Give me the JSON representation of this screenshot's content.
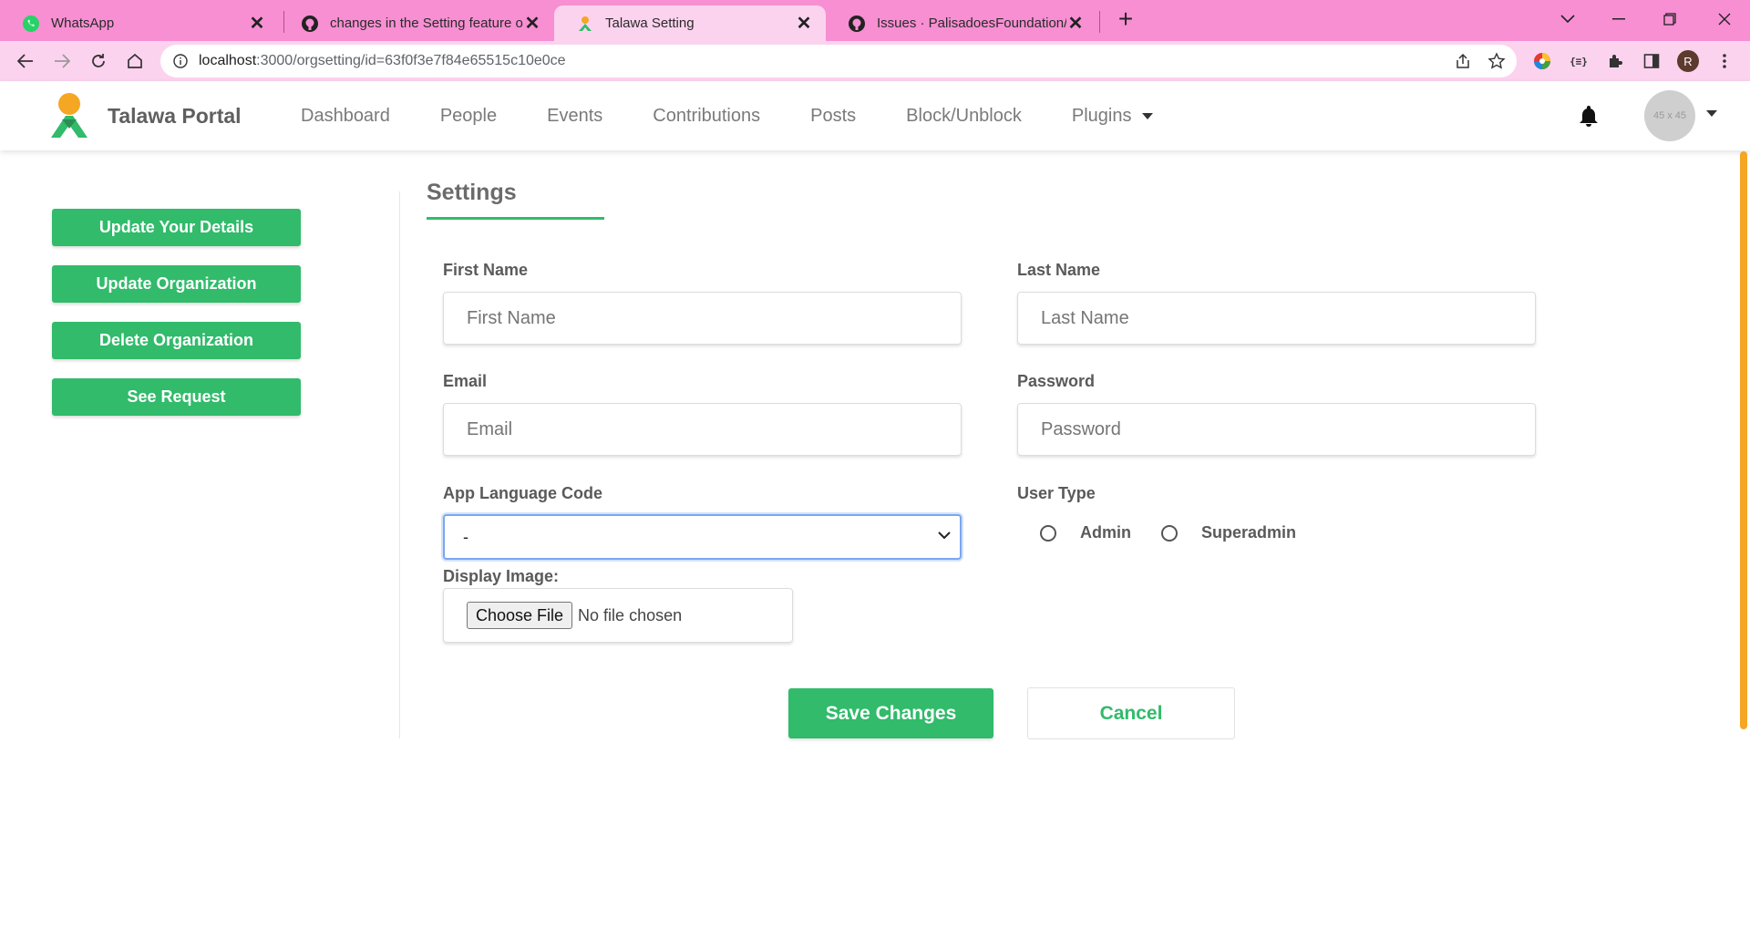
{
  "browser": {
    "tabs": [
      {
        "title": "WhatsApp",
        "icon": "whatsapp-icon"
      },
      {
        "title": "changes in the Setting feature of",
        "icon": "github-icon"
      },
      {
        "title": "Talawa Setting",
        "icon": "talawa-icon",
        "active": true
      },
      {
        "title": "Issues · PalisadoesFoundation/ta",
        "icon": "github-icon"
      }
    ],
    "url_host": "localhost",
    "url_path": ":3000/orgsetting/id=63f0f3e7f84e65515c10e0ce",
    "profile_initial": "R"
  },
  "header": {
    "brand": "Talawa Portal",
    "nav": [
      "Dashboard",
      "People",
      "Events",
      "Contributions",
      "Posts",
      "Block/Unblock",
      "Plugins"
    ],
    "avatar_text": "45 x 45"
  },
  "sidebar": {
    "buttons": [
      "Update Your Details",
      "Update Organization",
      "Delete Organization",
      "See Request"
    ]
  },
  "main": {
    "title": "Settings",
    "first_name": {
      "label": "First Name",
      "placeholder": "First Name"
    },
    "last_name": {
      "label": "Last Name",
      "placeholder": "Last Name"
    },
    "email": {
      "label": "Email",
      "placeholder": "Email"
    },
    "password": {
      "label": "Password",
      "placeholder": "Password"
    },
    "language": {
      "label": "App Language Code",
      "value": "-"
    },
    "user_type": {
      "label": "User Type",
      "options": [
        "Admin",
        "Superadmin"
      ]
    },
    "display_image": {
      "label": "Display Image:",
      "button": "Choose File",
      "status": "No file chosen"
    },
    "save": "Save Changes",
    "cancel": "Cancel"
  },
  "colors": {
    "accent": "#31bb6b",
    "tabbar": "#f78fd2",
    "toolbar": "#fcd3ee"
  }
}
